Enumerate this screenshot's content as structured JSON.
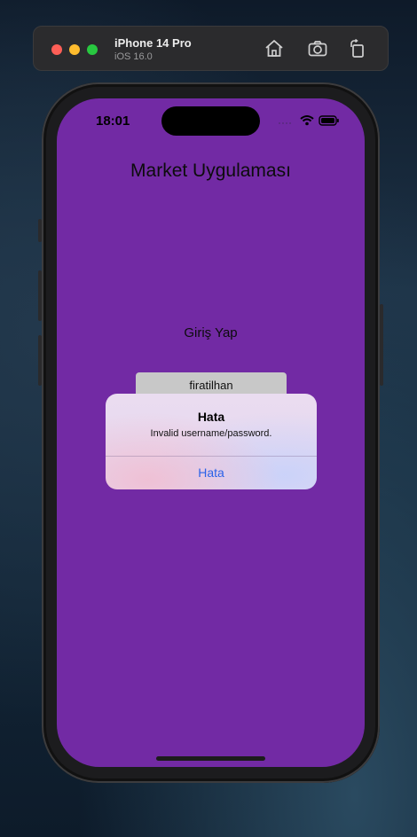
{
  "simulator": {
    "device_name": "iPhone 14 Pro",
    "os_version": "iOS 16.0",
    "icons": [
      "home-icon",
      "screenshot-icon",
      "rotate-icon"
    ]
  },
  "status_bar": {
    "time": "18:01",
    "icons": [
      "signal-icon",
      "wifi-icon",
      "battery-icon"
    ]
  },
  "app": {
    "title": "Market Uygulaması",
    "login_label": "Giriş Yap",
    "username_value": "firatilhan",
    "background_color": "#722aa4"
  },
  "alert": {
    "title": "Hata",
    "message": "Invalid username/password.",
    "button_label": "Hata",
    "button_color": "#2a62e8"
  }
}
